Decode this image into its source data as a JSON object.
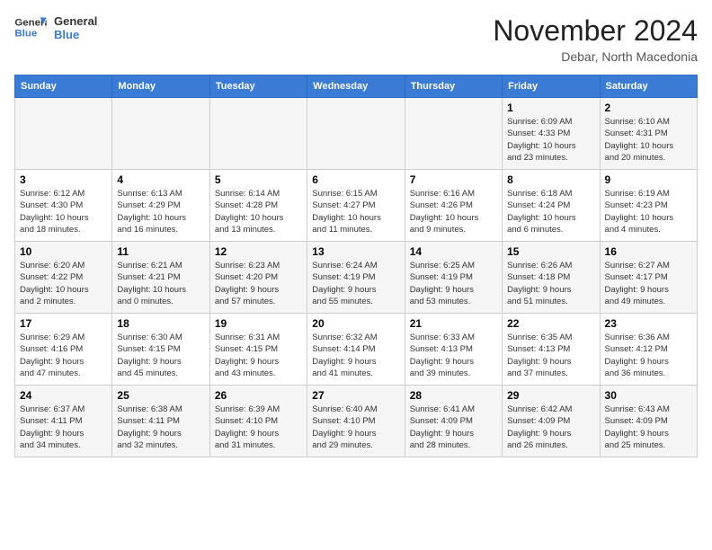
{
  "header": {
    "logo_line1": "General",
    "logo_line2": "Blue",
    "month": "November 2024",
    "location": "Debar, North Macedonia"
  },
  "days_of_week": [
    "Sunday",
    "Monday",
    "Tuesday",
    "Wednesday",
    "Thursday",
    "Friday",
    "Saturday"
  ],
  "weeks": [
    [
      {
        "day": "",
        "info": ""
      },
      {
        "day": "",
        "info": ""
      },
      {
        "day": "",
        "info": ""
      },
      {
        "day": "",
        "info": ""
      },
      {
        "day": "",
        "info": ""
      },
      {
        "day": "1",
        "info": "Sunrise: 6:09 AM\nSunset: 4:33 PM\nDaylight: 10 hours\nand 23 minutes."
      },
      {
        "day": "2",
        "info": "Sunrise: 6:10 AM\nSunset: 4:31 PM\nDaylight: 10 hours\nand 20 minutes."
      }
    ],
    [
      {
        "day": "3",
        "info": "Sunrise: 6:12 AM\nSunset: 4:30 PM\nDaylight: 10 hours\nand 18 minutes."
      },
      {
        "day": "4",
        "info": "Sunrise: 6:13 AM\nSunset: 4:29 PM\nDaylight: 10 hours\nand 16 minutes."
      },
      {
        "day": "5",
        "info": "Sunrise: 6:14 AM\nSunset: 4:28 PM\nDaylight: 10 hours\nand 13 minutes."
      },
      {
        "day": "6",
        "info": "Sunrise: 6:15 AM\nSunset: 4:27 PM\nDaylight: 10 hours\nand 11 minutes."
      },
      {
        "day": "7",
        "info": "Sunrise: 6:16 AM\nSunset: 4:26 PM\nDaylight: 10 hours\nand 9 minutes."
      },
      {
        "day": "8",
        "info": "Sunrise: 6:18 AM\nSunset: 4:24 PM\nDaylight: 10 hours\nand 6 minutes."
      },
      {
        "day": "9",
        "info": "Sunrise: 6:19 AM\nSunset: 4:23 PM\nDaylight: 10 hours\nand 4 minutes."
      }
    ],
    [
      {
        "day": "10",
        "info": "Sunrise: 6:20 AM\nSunset: 4:22 PM\nDaylight: 10 hours\nand 2 minutes."
      },
      {
        "day": "11",
        "info": "Sunrise: 6:21 AM\nSunset: 4:21 PM\nDaylight: 10 hours\nand 0 minutes."
      },
      {
        "day": "12",
        "info": "Sunrise: 6:23 AM\nSunset: 4:20 PM\nDaylight: 9 hours\nand 57 minutes."
      },
      {
        "day": "13",
        "info": "Sunrise: 6:24 AM\nSunset: 4:19 PM\nDaylight: 9 hours\nand 55 minutes."
      },
      {
        "day": "14",
        "info": "Sunrise: 6:25 AM\nSunset: 4:19 PM\nDaylight: 9 hours\nand 53 minutes."
      },
      {
        "day": "15",
        "info": "Sunrise: 6:26 AM\nSunset: 4:18 PM\nDaylight: 9 hours\nand 51 minutes."
      },
      {
        "day": "16",
        "info": "Sunrise: 6:27 AM\nSunset: 4:17 PM\nDaylight: 9 hours\nand 49 minutes."
      }
    ],
    [
      {
        "day": "17",
        "info": "Sunrise: 6:29 AM\nSunset: 4:16 PM\nDaylight: 9 hours\nand 47 minutes."
      },
      {
        "day": "18",
        "info": "Sunrise: 6:30 AM\nSunset: 4:15 PM\nDaylight: 9 hours\nand 45 minutes."
      },
      {
        "day": "19",
        "info": "Sunrise: 6:31 AM\nSunset: 4:15 PM\nDaylight: 9 hours\nand 43 minutes."
      },
      {
        "day": "20",
        "info": "Sunrise: 6:32 AM\nSunset: 4:14 PM\nDaylight: 9 hours\nand 41 minutes."
      },
      {
        "day": "21",
        "info": "Sunrise: 6:33 AM\nSunset: 4:13 PM\nDaylight: 9 hours\nand 39 minutes."
      },
      {
        "day": "22",
        "info": "Sunrise: 6:35 AM\nSunset: 4:13 PM\nDaylight: 9 hours\nand 37 minutes."
      },
      {
        "day": "23",
        "info": "Sunrise: 6:36 AM\nSunset: 4:12 PM\nDaylight: 9 hours\nand 36 minutes."
      }
    ],
    [
      {
        "day": "24",
        "info": "Sunrise: 6:37 AM\nSunset: 4:11 PM\nDaylight: 9 hours\nand 34 minutes."
      },
      {
        "day": "25",
        "info": "Sunrise: 6:38 AM\nSunset: 4:11 PM\nDaylight: 9 hours\nand 32 minutes."
      },
      {
        "day": "26",
        "info": "Sunrise: 6:39 AM\nSunset: 4:10 PM\nDaylight: 9 hours\nand 31 minutes."
      },
      {
        "day": "27",
        "info": "Sunrise: 6:40 AM\nSunset: 4:10 PM\nDaylight: 9 hours\nand 29 minutes."
      },
      {
        "day": "28",
        "info": "Sunrise: 6:41 AM\nSunset: 4:09 PM\nDaylight: 9 hours\nand 28 minutes."
      },
      {
        "day": "29",
        "info": "Sunrise: 6:42 AM\nSunset: 4:09 PM\nDaylight: 9 hours\nand 26 minutes."
      },
      {
        "day": "30",
        "info": "Sunrise: 6:43 AM\nSunset: 4:09 PM\nDaylight: 9 hours\nand 25 minutes."
      }
    ]
  ]
}
